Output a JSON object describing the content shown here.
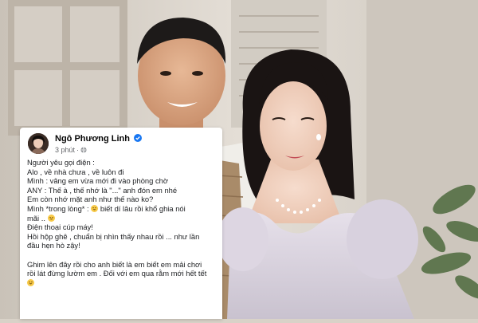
{
  "post": {
    "author": "Ngô Phương Linh",
    "time": "3 phút",
    "lines": [
      "Người yêu gọi điện :",
      "Alo , về nhà chưa , về luôn đi",
      "Mình : vâng em vừa mới đi vào phòng chờ",
      "ANY : Thế à , thế nhớ là \"...\" anh đón em nhé",
      "Em còn nhớ mặt anh như thế nào ko?",
      "Mình *trong lòng* :",
      "biết dí lâu rồi khổ ghia nói",
      "mãi ..",
      "Điện thoại cúp máy!",
      "Hồi hộp ghê , chuẩn bị nhìn thấy nhau rồi ... như lần",
      "đầu hẹn hò zậy!",
      "Ghim lên đây rồi cho anh biết là em biết em mải chơi",
      "rồi lát đừng lườm em . Đối với em qua rằm mới hết tết"
    ]
  },
  "icons": {
    "verified": "verified-badge-icon",
    "audience": "globe-icon",
    "emoji": "grinning-emoji-icon"
  },
  "colors": {
    "verified_blue": "#1877f2",
    "text": "#1c1e21",
    "meta": "#65676b"
  }
}
